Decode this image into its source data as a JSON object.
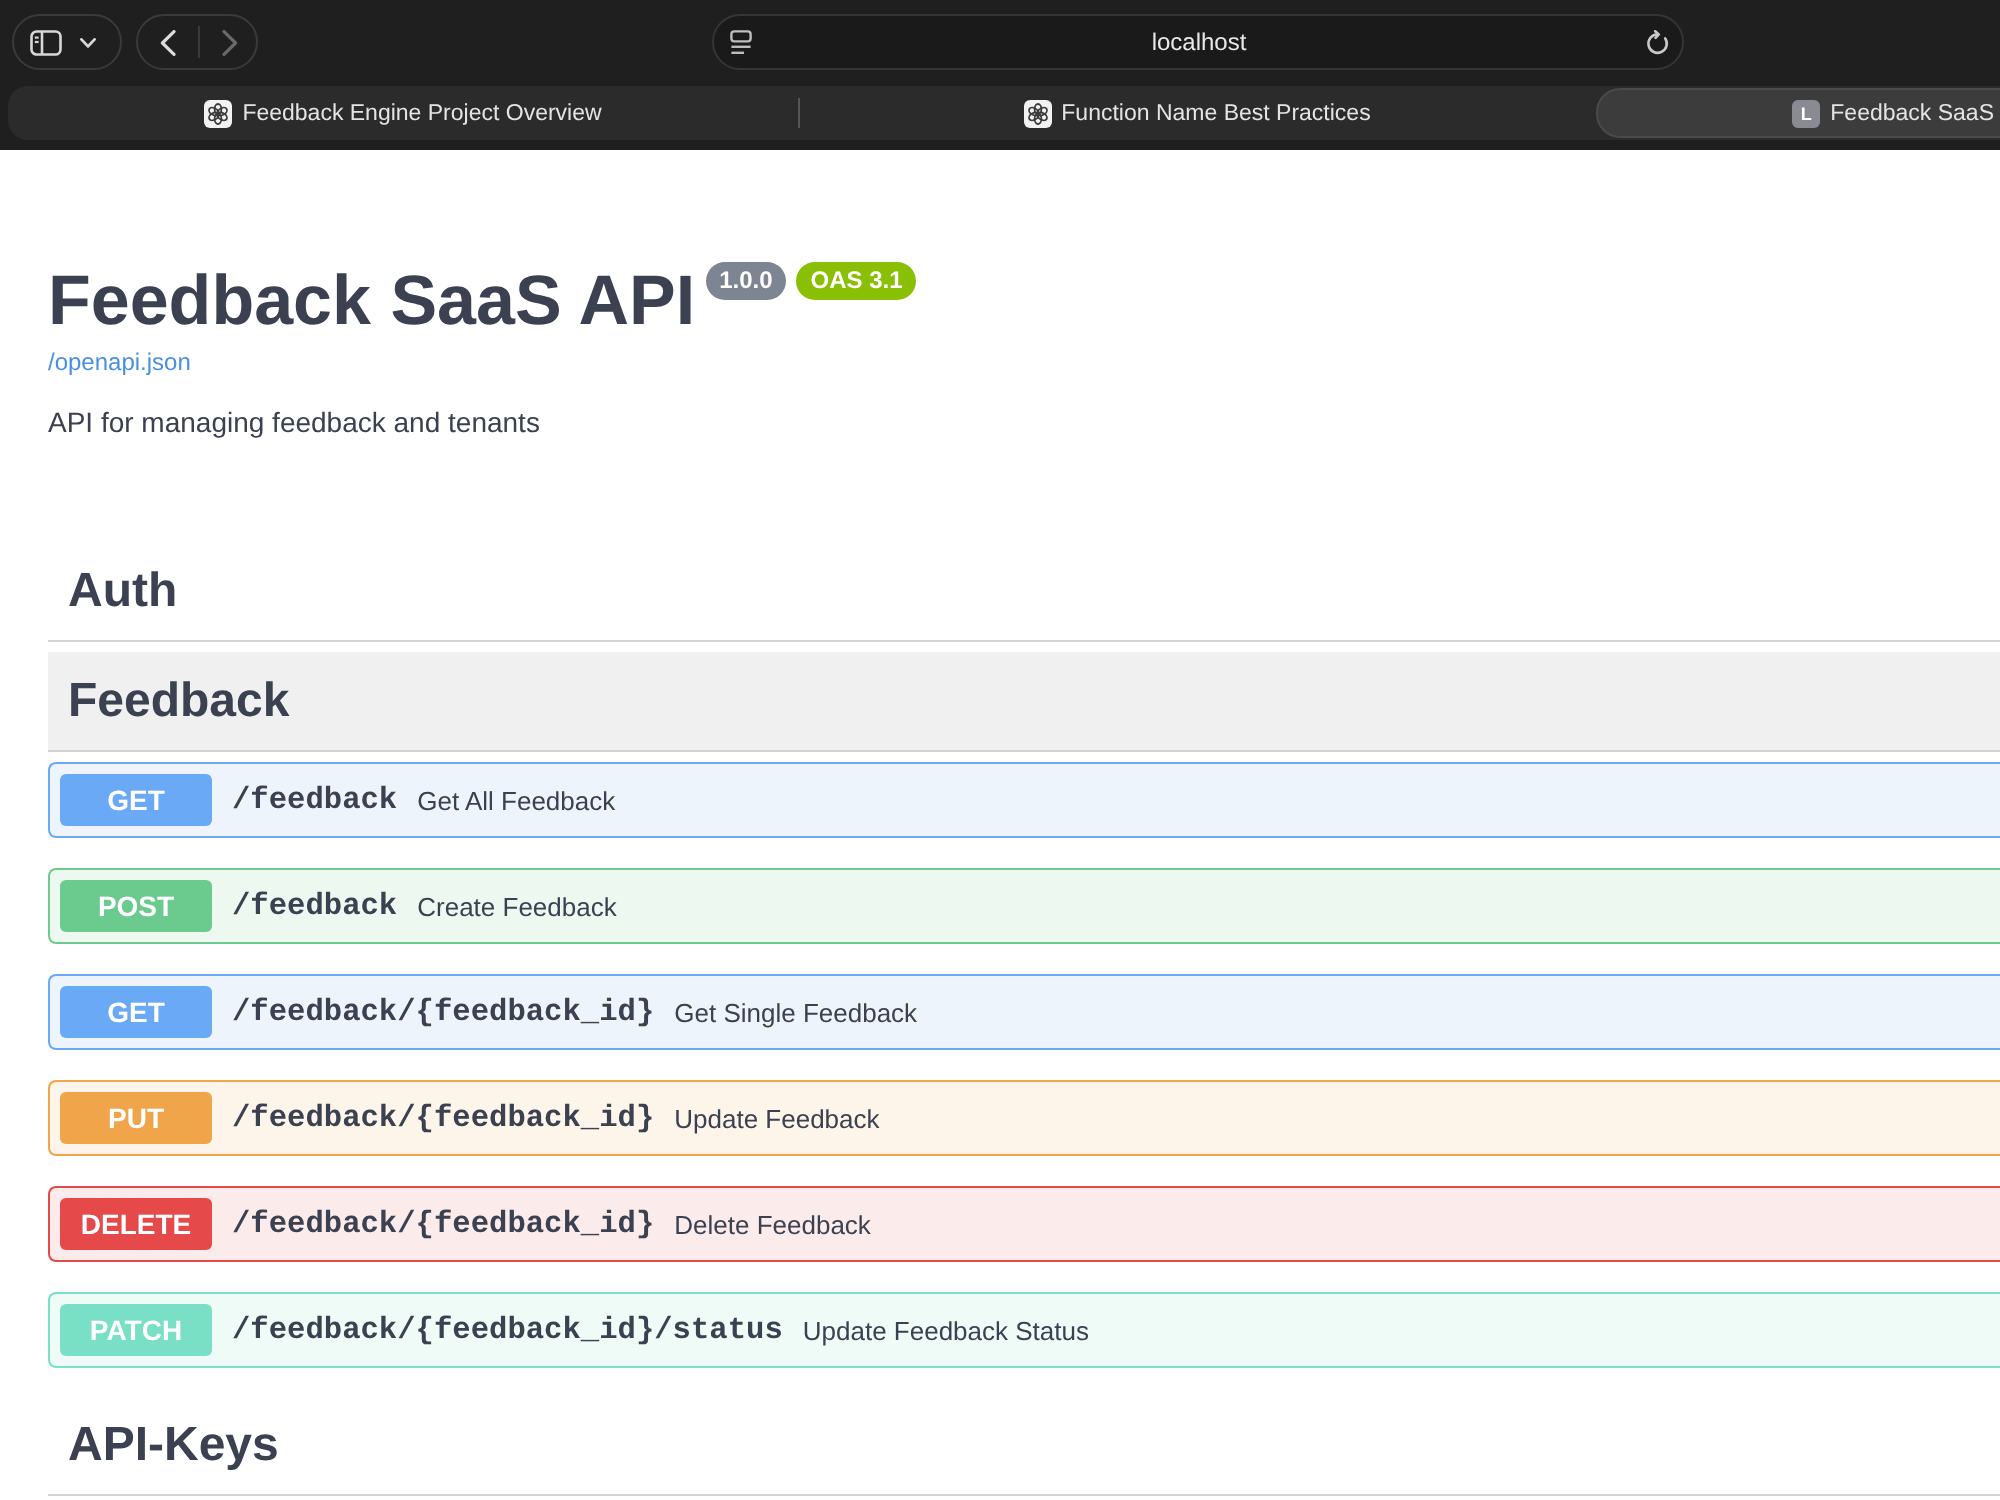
{
  "browser": {
    "back_disabled": false,
    "forward_disabled": true,
    "address": "localhost",
    "tabs": [
      {
        "kind": "icon",
        "title": "Feedback Engine Project Overview",
        "selected": false
      },
      {
        "kind": "icon",
        "title": "Function Name Best Practices",
        "selected": false
      },
      {
        "kind": "letter",
        "letter": "L",
        "title": "Feedback SaaS",
        "selected": true
      }
    ]
  },
  "info": {
    "title": "Feedback SaaS API",
    "version": "1.0.0",
    "spec": "OAS 3.1",
    "spec_link": "/openapi.json",
    "description": "API for managing feedback and tenants"
  },
  "sections": [
    {
      "name": "Auth",
      "hovered": false
    },
    {
      "name": "Feedback",
      "hovered": true,
      "operations": [
        {
          "kind": "get",
          "method": "GET",
          "path": "/feedback",
          "summary": "Get All Feedback"
        },
        {
          "kind": "post",
          "method": "POST",
          "path": "/feedback",
          "summary": "Create Feedback"
        },
        {
          "kind": "get",
          "method": "GET",
          "path": "/feedback/{feedback_id}",
          "summary": "Get Single Feedback"
        },
        {
          "kind": "put",
          "method": "PUT",
          "path": "/feedback/{feedback_id}",
          "summary": "Update Feedback"
        },
        {
          "kind": "delete",
          "method": "DELETE",
          "path": "/feedback/{feedback_id}",
          "summary": "Delete Feedback"
        },
        {
          "kind": "patch",
          "method": "PATCH",
          "path": "/feedback/{feedback_id}/status",
          "summary": "Update Feedback Status"
        }
      ]
    },
    {
      "name": "API-Keys",
      "hovered": false
    }
  ]
}
